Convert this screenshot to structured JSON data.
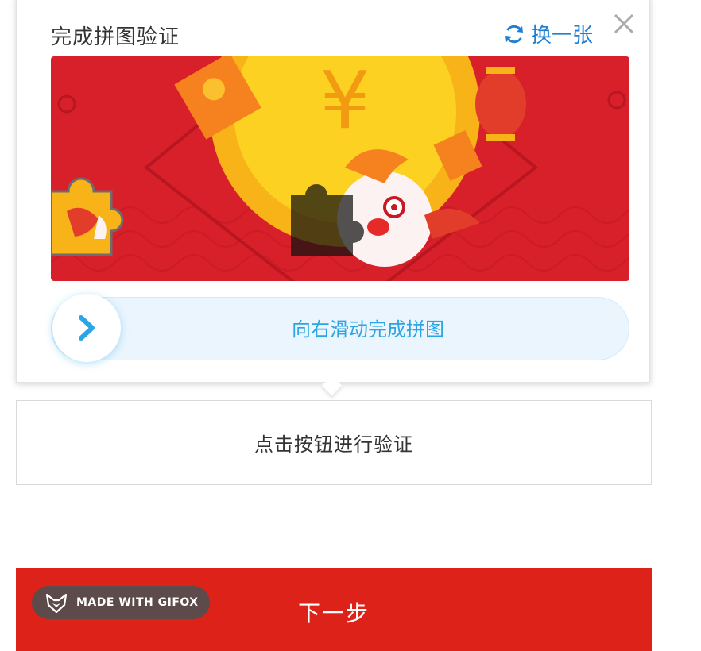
{
  "popup": {
    "title": "完成拼图验证",
    "refresh_label": "换一张",
    "slider_hint": "向右滑动完成拼图"
  },
  "verify_button": {
    "label": "点击按钮进行验证"
  },
  "next_button": {
    "label": "下一步"
  },
  "watermark": {
    "label": "MADE WITH GIFOX"
  },
  "colors": {
    "accent_blue": "#1e7fd3",
    "slider_text": "#2ba5e4",
    "brand_red": "#dc2219"
  },
  "icons": {
    "refresh": "refresh-icon",
    "close": "close-icon",
    "knob": "chevron-right-icon",
    "watermark": "fox-logo-icon"
  }
}
